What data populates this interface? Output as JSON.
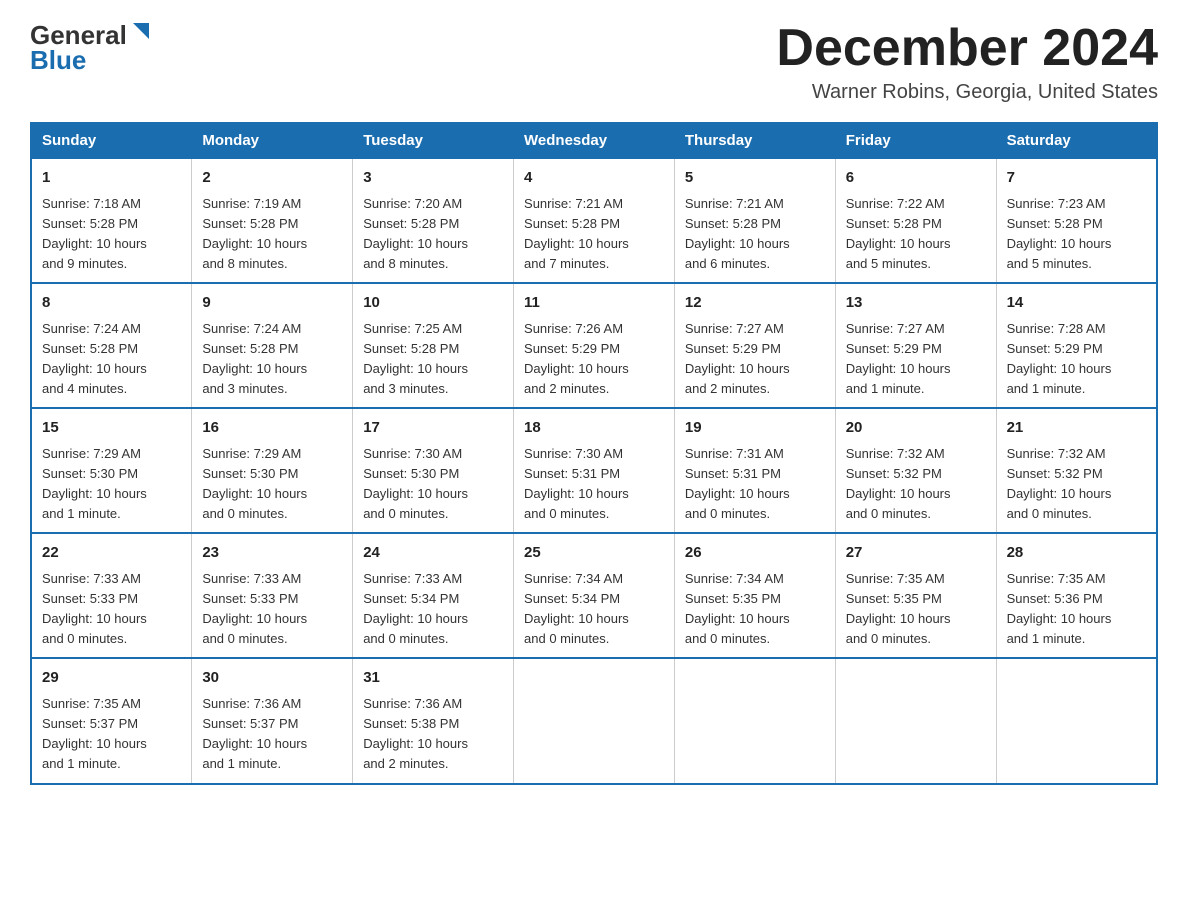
{
  "header": {
    "logo_line1": "General",
    "logo_line2": "Blue",
    "month_title": "December 2024",
    "location": "Warner Robins, Georgia, United States"
  },
  "days_of_week": [
    "Sunday",
    "Monday",
    "Tuesday",
    "Wednesday",
    "Thursday",
    "Friday",
    "Saturday"
  ],
  "weeks": [
    [
      {
        "day": "1",
        "sunrise": "7:18 AM",
        "sunset": "5:28 PM",
        "daylight": "10 hours and 9 minutes."
      },
      {
        "day": "2",
        "sunrise": "7:19 AM",
        "sunset": "5:28 PM",
        "daylight": "10 hours and 8 minutes."
      },
      {
        "day": "3",
        "sunrise": "7:20 AM",
        "sunset": "5:28 PM",
        "daylight": "10 hours and 8 minutes."
      },
      {
        "day": "4",
        "sunrise": "7:21 AM",
        "sunset": "5:28 PM",
        "daylight": "10 hours and 7 minutes."
      },
      {
        "day": "5",
        "sunrise": "7:21 AM",
        "sunset": "5:28 PM",
        "daylight": "10 hours and 6 minutes."
      },
      {
        "day": "6",
        "sunrise": "7:22 AM",
        "sunset": "5:28 PM",
        "daylight": "10 hours and 5 minutes."
      },
      {
        "day": "7",
        "sunrise": "7:23 AM",
        "sunset": "5:28 PM",
        "daylight": "10 hours and 5 minutes."
      }
    ],
    [
      {
        "day": "8",
        "sunrise": "7:24 AM",
        "sunset": "5:28 PM",
        "daylight": "10 hours and 4 minutes."
      },
      {
        "day": "9",
        "sunrise": "7:24 AM",
        "sunset": "5:28 PM",
        "daylight": "10 hours and 3 minutes."
      },
      {
        "day": "10",
        "sunrise": "7:25 AM",
        "sunset": "5:28 PM",
        "daylight": "10 hours and 3 minutes."
      },
      {
        "day": "11",
        "sunrise": "7:26 AM",
        "sunset": "5:29 PM",
        "daylight": "10 hours and 2 minutes."
      },
      {
        "day": "12",
        "sunrise": "7:27 AM",
        "sunset": "5:29 PM",
        "daylight": "10 hours and 2 minutes."
      },
      {
        "day": "13",
        "sunrise": "7:27 AM",
        "sunset": "5:29 PM",
        "daylight": "10 hours and 1 minute."
      },
      {
        "day": "14",
        "sunrise": "7:28 AM",
        "sunset": "5:29 PM",
        "daylight": "10 hours and 1 minute."
      }
    ],
    [
      {
        "day": "15",
        "sunrise": "7:29 AM",
        "sunset": "5:30 PM",
        "daylight": "10 hours and 1 minute."
      },
      {
        "day": "16",
        "sunrise": "7:29 AM",
        "sunset": "5:30 PM",
        "daylight": "10 hours and 0 minutes."
      },
      {
        "day": "17",
        "sunrise": "7:30 AM",
        "sunset": "5:30 PM",
        "daylight": "10 hours and 0 minutes."
      },
      {
        "day": "18",
        "sunrise": "7:30 AM",
        "sunset": "5:31 PM",
        "daylight": "10 hours and 0 minutes."
      },
      {
        "day": "19",
        "sunrise": "7:31 AM",
        "sunset": "5:31 PM",
        "daylight": "10 hours and 0 minutes."
      },
      {
        "day": "20",
        "sunrise": "7:32 AM",
        "sunset": "5:32 PM",
        "daylight": "10 hours and 0 minutes."
      },
      {
        "day": "21",
        "sunrise": "7:32 AM",
        "sunset": "5:32 PM",
        "daylight": "10 hours and 0 minutes."
      }
    ],
    [
      {
        "day": "22",
        "sunrise": "7:33 AM",
        "sunset": "5:33 PM",
        "daylight": "10 hours and 0 minutes."
      },
      {
        "day": "23",
        "sunrise": "7:33 AM",
        "sunset": "5:33 PM",
        "daylight": "10 hours and 0 minutes."
      },
      {
        "day": "24",
        "sunrise": "7:33 AM",
        "sunset": "5:34 PM",
        "daylight": "10 hours and 0 minutes."
      },
      {
        "day": "25",
        "sunrise": "7:34 AM",
        "sunset": "5:34 PM",
        "daylight": "10 hours and 0 minutes."
      },
      {
        "day": "26",
        "sunrise": "7:34 AM",
        "sunset": "5:35 PM",
        "daylight": "10 hours and 0 minutes."
      },
      {
        "day": "27",
        "sunrise": "7:35 AM",
        "sunset": "5:35 PM",
        "daylight": "10 hours and 0 minutes."
      },
      {
        "day": "28",
        "sunrise": "7:35 AM",
        "sunset": "5:36 PM",
        "daylight": "10 hours and 1 minute."
      }
    ],
    [
      {
        "day": "29",
        "sunrise": "7:35 AM",
        "sunset": "5:37 PM",
        "daylight": "10 hours and 1 minute."
      },
      {
        "day": "30",
        "sunrise": "7:36 AM",
        "sunset": "5:37 PM",
        "daylight": "10 hours and 1 minute."
      },
      {
        "day": "31",
        "sunrise": "7:36 AM",
        "sunset": "5:38 PM",
        "daylight": "10 hours and 2 minutes."
      },
      null,
      null,
      null,
      null
    ]
  ],
  "labels": {
    "sunrise": "Sunrise:",
    "sunset": "Sunset:",
    "daylight": "Daylight:"
  }
}
